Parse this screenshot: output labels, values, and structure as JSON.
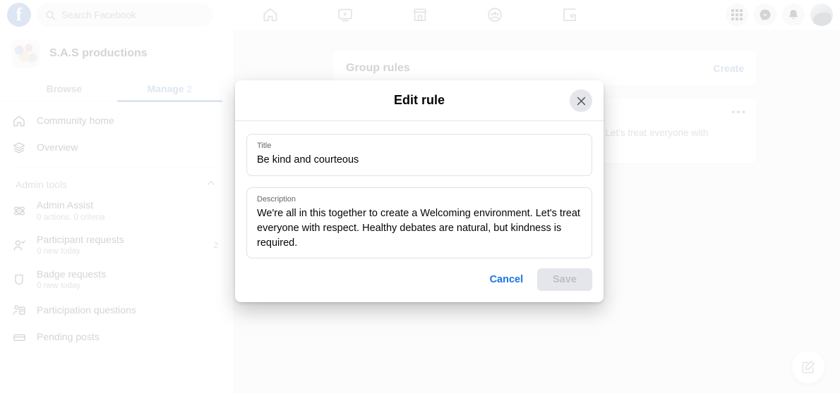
{
  "topbar": {
    "logo": "facebook-logo",
    "search_placeholder": "Search Facebook",
    "nav_icons": [
      "home-icon",
      "video-icon",
      "marketplace-icon",
      "groups-icon",
      "gaming-icon"
    ],
    "right_icons": [
      "menu-grid-icon",
      "messenger-icon",
      "notifications-icon",
      "profile-avatar"
    ]
  },
  "sidebar": {
    "group_name": "S.A.S productions",
    "tabs": [
      {
        "label": "Browse",
        "active": false,
        "count": ""
      },
      {
        "label": "Manage",
        "active": true,
        "count": "2"
      }
    ],
    "nav": [
      {
        "label": "Community home",
        "sub": "",
        "badge": "",
        "icon": "home-outline-icon"
      },
      {
        "label": "Overview",
        "sub": "",
        "badge": "",
        "icon": "layers-icon"
      }
    ],
    "section_title": "Admin tools",
    "section_chevron": "chevron-up-icon",
    "tools": [
      {
        "label": "Admin Assist",
        "sub": "0 actions, 0 criteria",
        "badge": "",
        "icon": "gear-atom-icon"
      },
      {
        "label": "Participant requests",
        "sub": "0 new today",
        "badge": "2",
        "icon": "person-check-icon"
      },
      {
        "label": "Badge requests",
        "sub": "0 new today",
        "badge": "",
        "icon": "shield-icon"
      },
      {
        "label": "Participation questions",
        "sub": "",
        "badge": "",
        "icon": "person-form-icon"
      },
      {
        "label": "Pending posts",
        "sub": "",
        "badge": "",
        "icon": "post-icon"
      }
    ]
  },
  "main": {
    "rules_title": "Group rules",
    "create_label": "Create",
    "rule_card": {
      "title": "Be kind and courteous",
      "body": "We're all in this together to create a Welcoming environment. Let's treat everyone with respect.",
      "menu_icon": "ellipsis-icon"
    },
    "fab_icon": "compose-icon"
  },
  "modal": {
    "title": "Edit rule",
    "close_icon": "close-icon",
    "title_field": {
      "label": "Title",
      "value": "Be kind and courteous"
    },
    "description_field": {
      "label": "Description",
      "value": "We're all in this together to create a Welcoming environment. Let's treat everyone with respect. Healthy debates are natural, but kindness is required."
    },
    "cancel_label": "Cancel",
    "save_label": "Save"
  },
  "colors": {
    "accent": "#1b74e4",
    "page_bg": "#f0f2f5",
    "disabled_btn_bg": "#e4e6eb",
    "disabled_btn_text": "#bcc0c4"
  }
}
